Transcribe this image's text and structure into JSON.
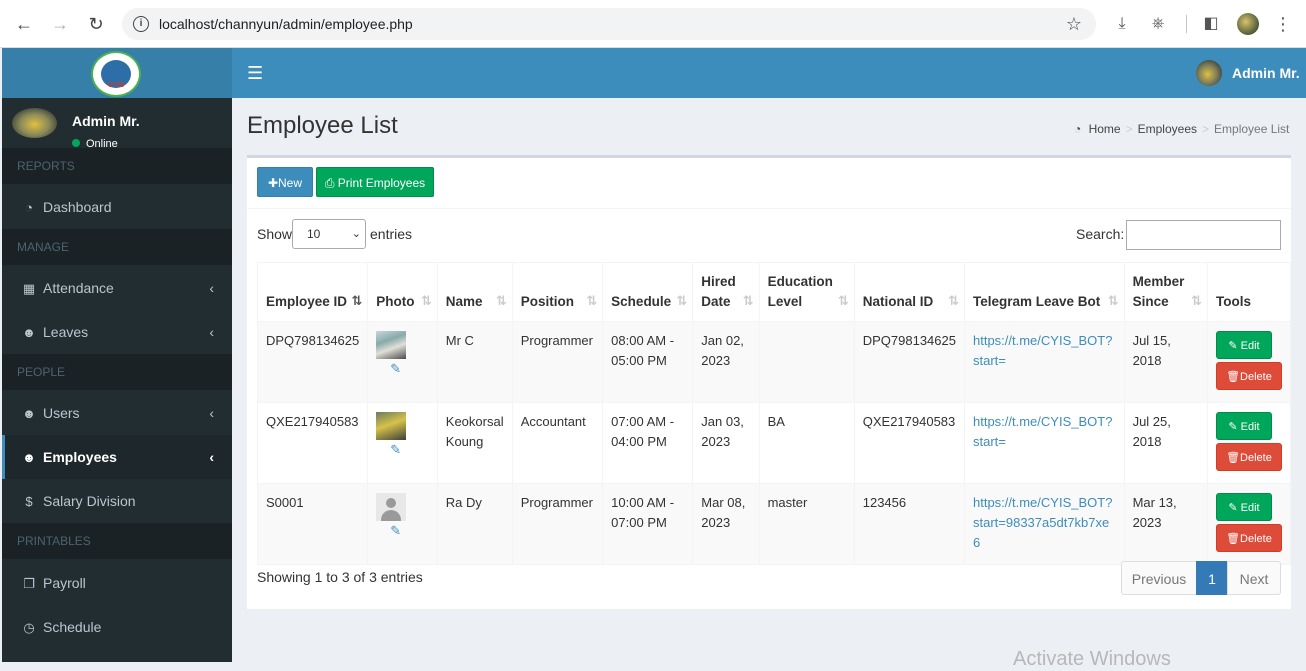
{
  "browser": {
    "url": "localhost/channyun/admin/employee.php",
    "back_icon": "arrow-left",
    "forward_icon": "arrow-right",
    "reload_icon": "reload",
    "info_icon": "info",
    "bookmark_icon": "star",
    "download_icon": "download",
    "extensions_icon": "puzzle",
    "sidepanel_icon": "side-panel",
    "menu_icon": "kebab"
  },
  "logo": {
    "text": "CYIS"
  },
  "sidebar": {
    "user": {
      "name": "Admin Mr.",
      "status": "Online"
    },
    "sections": [
      {
        "header": "REPORTS",
        "items": [
          {
            "label": "Dashboard",
            "icon": "dashboard"
          }
        ]
      },
      {
        "header": "MANAGE",
        "items": [
          {
            "label": "Attendance",
            "icon": "calendar"
          },
          {
            "label": "Leaves",
            "icon": "users"
          }
        ]
      },
      {
        "header": "PEOPLE",
        "items": [
          {
            "label": "Users",
            "icon": "users"
          },
          {
            "label": "Employees",
            "icon": "users",
            "active": true
          },
          {
            "label": "Salary Division",
            "icon": "dollar"
          }
        ]
      },
      {
        "header": "PRINTABLES",
        "items": [
          {
            "label": "Payroll",
            "icon": "files"
          },
          {
            "label": "Schedule",
            "icon": "clock"
          }
        ]
      }
    ]
  },
  "header": {
    "user_name": "Admin Mr."
  },
  "page": {
    "title": "Employee List",
    "breadcrumb": {
      "home": "Home",
      "section": "Employees",
      "current": "Employee List"
    }
  },
  "toolbar": {
    "new_label": "New",
    "print_label": "Print Employees"
  },
  "table_controls": {
    "show_label": "Show",
    "entries_value": "10",
    "entries_label": "entries",
    "search_label": "Search:"
  },
  "table": {
    "columns": [
      "Employee ID",
      "Photo",
      "Name",
      "Position",
      "Schedule",
      "Hired Date",
      "Education Level",
      "National ID",
      "Telegram Leave Bot",
      "Member Since",
      "Tools"
    ],
    "rows": [
      {
        "employee_id": "DPQ798134625",
        "name": "Mr C",
        "position": "Programmer",
        "schedule": "08:00 AM - 05:00 PM",
        "hired": "Jan 02, 2023",
        "education": "",
        "national_id": "DPQ798134625",
        "telegram": "https://t.me/CYIS_BOT?start=",
        "member_since": "Jul 15, 2018"
      },
      {
        "employee_id": "QXE217940583",
        "name": "Keokorsal Koung",
        "position": "Accountant",
        "schedule": "07:00 AM - 04:00 PM",
        "hired": "Jan 03, 2023",
        "education": "BA",
        "national_id": "QXE217940583",
        "telegram": "https://t.me/CYIS_BOT?start=",
        "member_since": "Jul 25, 2018"
      },
      {
        "employee_id": "S0001",
        "name": "Ra Dy",
        "position": "Programmer",
        "schedule": "10:00 AM - 07:00 PM",
        "hired": "Mar 08, 2023",
        "education": "master",
        "national_id": "123456",
        "telegram": "https://t.me/CYIS_BOT?start=98337a5dt7kb7xe6",
        "member_since": "Mar 13, 2023"
      }
    ],
    "edit_label": "Edit",
    "delete_label": "Delete"
  },
  "footer": {
    "info": "Showing 1 to 3 of 3 entries",
    "prev": "Previous",
    "page": "1",
    "next": "Next"
  },
  "watermark": "Activate Windows",
  "colors": {
    "primary": "#3c8dbc",
    "success": "#00a65a",
    "danger": "#dd4b39",
    "sidebar": "#222d32"
  }
}
